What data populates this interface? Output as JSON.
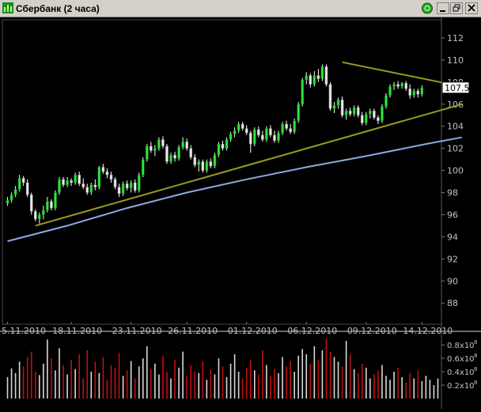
{
  "window": {
    "title": "Сбербанк (2 часа)",
    "app_icon": "chart-app-icon",
    "buttons": [
      "status-indicator-icon",
      "minimize-icon",
      "restore-icon",
      "close-icon"
    ]
  },
  "colors": {
    "background": "#000000",
    "up_candle": "#2ee53a",
    "down_candle": "#e8e8e8",
    "wick": "#ffffff",
    "trendline": "#9a9a1e",
    "moving_average": "#8fa8e0",
    "volume_up": "#d8d8d8",
    "volume_down": "#c01010",
    "axis_text": "#c0c0c0",
    "price_label_bg": "#ffffff"
  },
  "chart_data": [
    {
      "type": "candlestick",
      "ylim": [
        86.8,
        113.5
      ],
      "yticks": [
        88,
        90,
        92,
        94,
        96,
        98,
        100,
        102,
        104,
        106,
        108,
        110,
        112
      ],
      "ytick_labels": [
        "88",
        "90",
        "92",
        "94",
        "96",
        "98",
        "100",
        "102",
        "104",
        "106",
        "108",
        "110",
        "112"
      ],
      "x_date_labels": [
        "5.11.2010",
        "18.11.2010",
        "23.11.2010",
        "26.11.2010",
        "01.12.2010",
        "06.12.2010",
        "09.12.2010",
        "14.12.2010"
      ],
      "x_date_label_bar_index": [
        0,
        16,
        31,
        45,
        60,
        75,
        90,
        104
      ],
      "current_price_label": "107.5",
      "candles": [
        [
          97.0,
          97.6,
          96.8,
          97.3
        ],
        [
          97.3,
          98.0,
          97.1,
          97.8
        ],
        [
          97.8,
          98.6,
          97.6,
          98.3
        ],
        [
          98.3,
          99.6,
          98.1,
          99.3
        ],
        [
          99.3,
          99.5,
          98.6,
          98.9
        ],
        [
          98.9,
          99.2,
          97.6,
          97.8
        ],
        [
          97.8,
          98.0,
          96.0,
          96.3
        ],
        [
          96.3,
          96.5,
          95.4,
          95.6
        ],
        [
          95.6,
          96.2,
          95.2,
          96.0
        ],
        [
          96.0,
          96.8,
          95.6,
          96.4
        ],
        [
          96.4,
          97.6,
          96.2,
          97.2
        ],
        [
          97.2,
          97.4,
          96.4,
          96.6
        ],
        [
          96.6,
          98.2,
          96.4,
          98.0
        ],
        [
          98.0,
          99.4,
          97.8,
          99.2
        ],
        [
          99.2,
          99.4,
          98.5,
          98.7
        ],
        [
          98.7,
          99.4,
          98.5,
          99.1
        ],
        [
          99.1,
          99.3,
          98.6,
          98.9
        ],
        [
          98.9,
          99.8,
          98.7,
          99.6
        ],
        [
          99.6,
          99.9,
          98.6,
          98.8
        ],
        [
          98.8,
          99.3,
          98.3,
          98.5
        ],
        [
          98.5,
          98.8,
          97.8,
          98.0
        ],
        [
          98.0,
          98.9,
          97.8,
          98.7
        ],
        [
          98.7,
          99.2,
          98.2,
          98.5
        ],
        [
          98.5,
          100.4,
          98.3,
          100.3
        ],
        [
          100.3,
          100.6,
          99.7,
          99.9
        ],
        [
          99.9,
          100.2,
          99.3,
          99.6
        ],
        [
          99.6,
          99.9,
          98.9,
          99.2
        ],
        [
          99.2,
          99.4,
          98.3,
          98.5
        ],
        [
          98.5,
          98.8,
          97.6,
          97.9
        ],
        [
          97.9,
          99.0,
          97.7,
          98.8
        ],
        [
          98.8,
          99.1,
          98.2,
          98.4
        ],
        [
          98.4,
          99.1,
          98.0,
          98.9
        ],
        [
          98.9,
          99.2,
          98.0,
          98.2
        ],
        [
          98.2,
          99.8,
          98.0,
          99.6
        ],
        [
          99.6,
          101.2,
          99.4,
          101.0
        ],
        [
          101.0,
          102.4,
          100.8,
          102.2
        ],
        [
          102.2,
          102.6,
          101.6,
          101.8
        ],
        [
          101.8,
          102.3,
          101.3,
          102.0
        ],
        [
          102.0,
          103.0,
          101.8,
          102.8
        ],
        [
          102.8,
          103.1,
          102.0,
          102.2
        ],
        [
          102.2,
          102.4,
          100.6,
          100.8
        ],
        [
          100.8,
          101.6,
          100.6,
          101.4
        ],
        [
          101.4,
          101.7,
          100.8,
          101.1
        ],
        [
          101.1,
          102.3,
          100.9,
          102.1
        ],
        [
          102.1,
          103.0,
          101.9,
          102.6
        ],
        [
          102.6,
          102.9,
          101.8,
          102.0
        ],
        [
          102.0,
          102.3,
          101.0,
          101.2
        ],
        [
          101.2,
          101.5,
          100.3,
          100.5
        ],
        [
          100.5,
          101.0,
          99.9,
          100.8
        ],
        [
          100.8,
          101.0,
          99.8,
          100.0
        ],
        [
          100.0,
          101.0,
          99.8,
          100.8
        ],
        [
          100.8,
          101.1,
          100.2,
          100.4
        ],
        [
          100.4,
          101.6,
          100.2,
          101.4
        ],
        [
          101.4,
          102.6,
          101.2,
          102.4
        ],
        [
          102.4,
          102.7,
          101.8,
          102.0
        ],
        [
          102.0,
          103.0,
          101.8,
          102.8
        ],
        [
          102.8,
          103.5,
          102.6,
          103.3
        ],
        [
          103.3,
          103.9,
          103.0,
          103.6
        ],
        [
          103.6,
          104.4,
          103.4,
          104.2
        ],
        [
          104.2,
          104.4,
          103.6,
          103.8
        ],
        [
          103.8,
          104.1,
          103.2,
          103.4
        ],
        [
          103.4,
          103.6,
          101.6,
          102.4
        ],
        [
          102.4,
          103.9,
          102.2,
          103.7
        ],
        [
          103.7,
          104.0,
          103.0,
          103.2
        ],
        [
          103.2,
          103.6,
          102.6,
          102.8
        ],
        [
          102.8,
          104.0,
          102.6,
          103.8
        ],
        [
          103.8,
          104.1,
          103.0,
          103.2
        ],
        [
          103.2,
          103.6,
          102.5,
          102.7
        ],
        [
          102.7,
          103.6,
          102.5,
          103.4
        ],
        [
          103.4,
          104.4,
          103.2,
          104.2
        ],
        [
          104.2,
          104.5,
          103.6,
          103.8
        ],
        [
          103.8,
          104.2,
          103.3,
          103.5
        ],
        [
          103.5,
          104.7,
          103.3,
          104.5
        ],
        [
          104.5,
          106.2,
          104.3,
          106.0
        ],
        [
          106.0,
          108.4,
          105.8,
          108.2
        ],
        [
          108.2,
          108.9,
          107.8,
          108.6
        ],
        [
          108.6,
          108.8,
          107.5,
          107.8
        ],
        [
          107.8,
          109.0,
          107.6,
          108.6
        ],
        [
          108.6,
          109.2,
          108.0,
          108.3
        ],
        [
          108.3,
          109.6,
          108.1,
          109.4
        ],
        [
          109.4,
          109.6,
          107.6,
          107.8
        ],
        [
          107.8,
          108.0,
          105.4,
          105.6
        ],
        [
          105.6,
          106.2,
          105.2,
          105.9
        ],
        [
          105.9,
          106.6,
          105.6,
          106.4
        ],
        [
          106.4,
          106.7,
          104.8,
          105.0
        ],
        [
          105.0,
          105.6,
          104.6,
          105.4
        ],
        [
          105.4,
          105.7,
          104.9,
          105.1
        ],
        [
          105.1,
          105.9,
          104.9,
          105.7
        ],
        [
          105.7,
          105.9,
          104.8,
          105.0
        ],
        [
          105.0,
          105.3,
          104.1,
          104.3
        ],
        [
          104.3,
          105.3,
          104.1,
          105.1
        ],
        [
          105.1,
          105.6,
          104.7,
          105.4
        ],
        [
          105.4,
          105.6,
          104.6,
          104.8
        ],
        [
          104.8,
          105.0,
          104.2,
          104.5
        ],
        [
          104.5,
          106.0,
          104.3,
          105.8
        ],
        [
          105.8,
          107.0,
          105.6,
          106.8
        ],
        [
          106.8,
          107.8,
          106.6,
          107.6
        ],
        [
          107.6,
          108.0,
          107.3,
          107.8
        ],
        [
          107.8,
          108.1,
          107.4,
          107.6
        ],
        [
          107.6,
          108.0,
          107.4,
          107.9
        ],
        [
          107.9,
          108.1,
          107.2,
          107.4
        ],
        [
          107.4,
          107.8,
          106.5,
          106.8
        ],
        [
          106.8,
          107.4,
          106.6,
          107.2
        ],
        [
          107.2,
          107.4,
          106.6,
          106.9
        ],
        [
          106.9,
          107.7,
          106.7,
          107.5
        ]
      ],
      "moving_average": {
        "x": [
          0,
          15,
          30,
          45,
          60,
          75,
          90,
          105,
          114
        ],
        "y": [
          93.6,
          95.0,
          96.6,
          98.0,
          99.2,
          100.3,
          101.3,
          102.4,
          103.0
        ]
      },
      "trendlines": [
        {
          "x": [
            7,
            114
          ],
          "y": [
            95.0,
            106.0
          ]
        },
        {
          "x": [
            84,
            114
          ],
          "y": [
            109.8,
            107.6
          ]
        }
      ]
    },
    {
      "type": "bar",
      "ylim": [
        0,
        0.92
      ],
      "yticks": [
        0.2,
        0.4,
        0.6,
        0.8
      ],
      "ytick_labels": [
        "0.2x10",
        "0.4x10",
        "0.6x10",
        "0.8x10"
      ],
      "ytick_exponent": "8",
      "values": [
        0.32,
        0.45,
        0.38,
        0.55,
        0.48,
        0.62,
        0.7,
        0.4,
        0.35,
        0.52,
        0.88,
        0.6,
        0.42,
        0.75,
        0.5,
        0.36,
        0.58,
        0.44,
        0.66,
        0.3,
        0.72,
        0.4,
        0.55,
        0.38,
        0.62,
        0.28,
        0.5,
        0.46,
        0.68,
        0.34,
        0.42,
        0.56,
        0.3,
        0.48,
        0.6,
        0.78,
        0.44,
        0.52,
        0.36,
        0.64,
        0.4,
        0.3,
        0.58,
        0.46,
        0.7,
        0.34,
        0.5,
        0.4,
        0.38,
        0.56,
        0.28,
        0.44,
        0.36,
        0.6,
        0.48,
        0.32,
        0.52,
        0.66,
        0.4,
        0.3,
        0.46,
        0.58,
        0.42,
        0.36,
        0.72,
        0.5,
        0.34,
        0.44,
        0.38,
        0.62,
        0.48,
        0.56,
        0.4,
        0.64,
        0.74,
        0.66,
        0.52,
        0.78,
        0.58,
        0.72,
        0.9,
        0.7,
        0.62,
        0.55,
        0.48,
        0.86,
        0.66,
        0.44,
        0.38,
        0.52,
        0.46,
        0.3,
        0.36,
        0.42,
        0.5,
        0.34,
        0.28,
        0.4,
        0.46,
        0.32,
        0.24,
        0.38,
        0.3,
        0.42,
        0.26,
        0.34,
        0.28,
        0.2,
        0.3
      ]
    }
  ]
}
